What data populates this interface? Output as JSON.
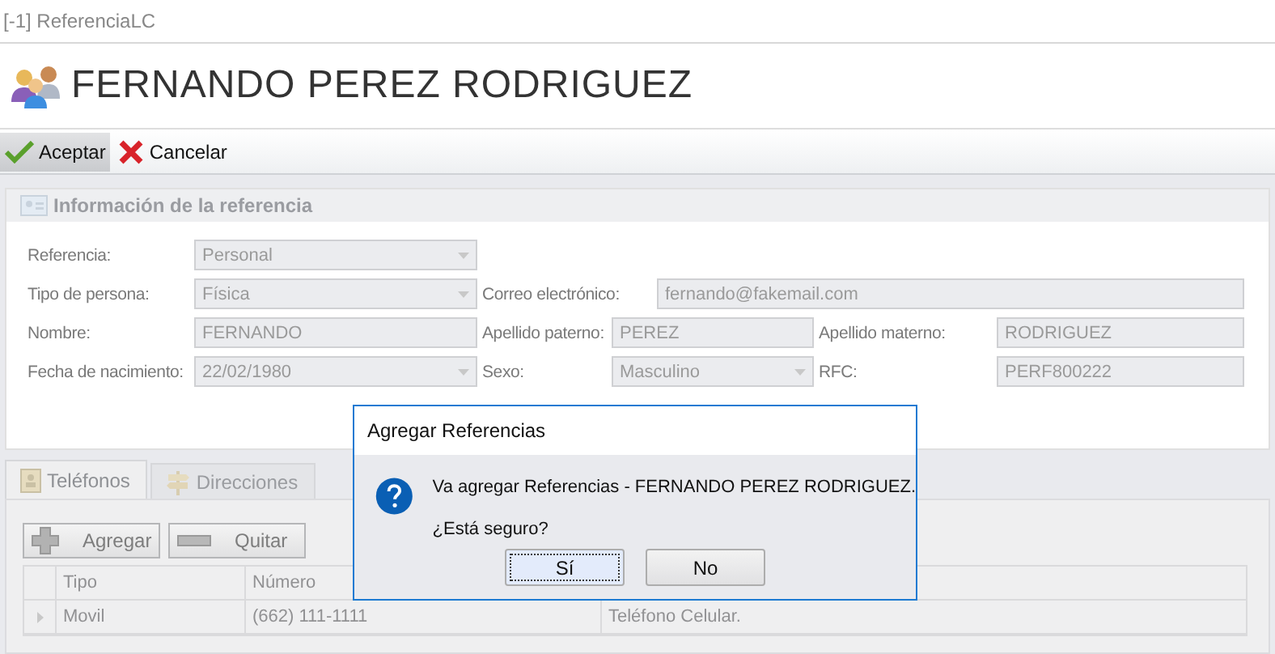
{
  "window": {
    "title": "[-1] ReferenciaLC"
  },
  "header": {
    "title": "FERNANDO PEREZ RODRIGUEZ"
  },
  "toolbar": [
    {
      "label": "Aceptar",
      "highlighted": true
    },
    {
      "label": "Cancelar",
      "highlighted": false
    }
  ],
  "reference_panel": {
    "title": "Información de la referencia",
    "rows": [
      [
        {
          "label": "Referencia:",
          "value": "Personal",
          "kind": "dropdown"
        }
      ],
      [
        {
          "label": "Tipo de persona:",
          "value": "Física",
          "kind": "dropdown"
        },
        {
          "label": "Correo electrónico:",
          "value": "fernando@fakemail.com",
          "kind": "text"
        }
      ],
      [
        {
          "label": "Nombre:",
          "value": "FERNANDO",
          "kind": "text"
        },
        {
          "label": "Apellido paterno:",
          "value": "PEREZ",
          "kind": "text"
        },
        {
          "label": "Apellido materno:",
          "value": "RODRIGUEZ",
          "kind": "text"
        }
      ],
      [
        {
          "label": "Fecha de nacimiento:",
          "value": "22/02/1980",
          "kind": "dropdown"
        },
        {
          "label": "Sexo:",
          "value": "Masculino",
          "kind": "dropdown"
        },
        {
          "label": "RFC:",
          "value": "PERF800222",
          "kind": "text"
        }
      ]
    ]
  },
  "tabs": [
    {
      "label": "Teléfonos",
      "selected": true
    },
    {
      "label": "Direcciones",
      "selected": false
    }
  ],
  "phone_actions": [
    "Agregar",
    "Quitar"
  ],
  "phones_grid": {
    "columns": [
      "Tipo",
      "Número"
    ],
    "rows": [
      {
        "cells": [
          "Movil",
          "(662) 111-1111",
          "Teléfono Celular."
        ]
      }
    ]
  },
  "dialog": {
    "title": "Agregar Referencias",
    "message": "Va agregar Referencias - FERNANDO PEREZ RODRIGUEZ.",
    "question": "¿Está seguro?",
    "buttons": [
      {
        "label": "Sí",
        "focused": true
      },
      {
        "label": "No",
        "focused": false
      }
    ]
  }
}
